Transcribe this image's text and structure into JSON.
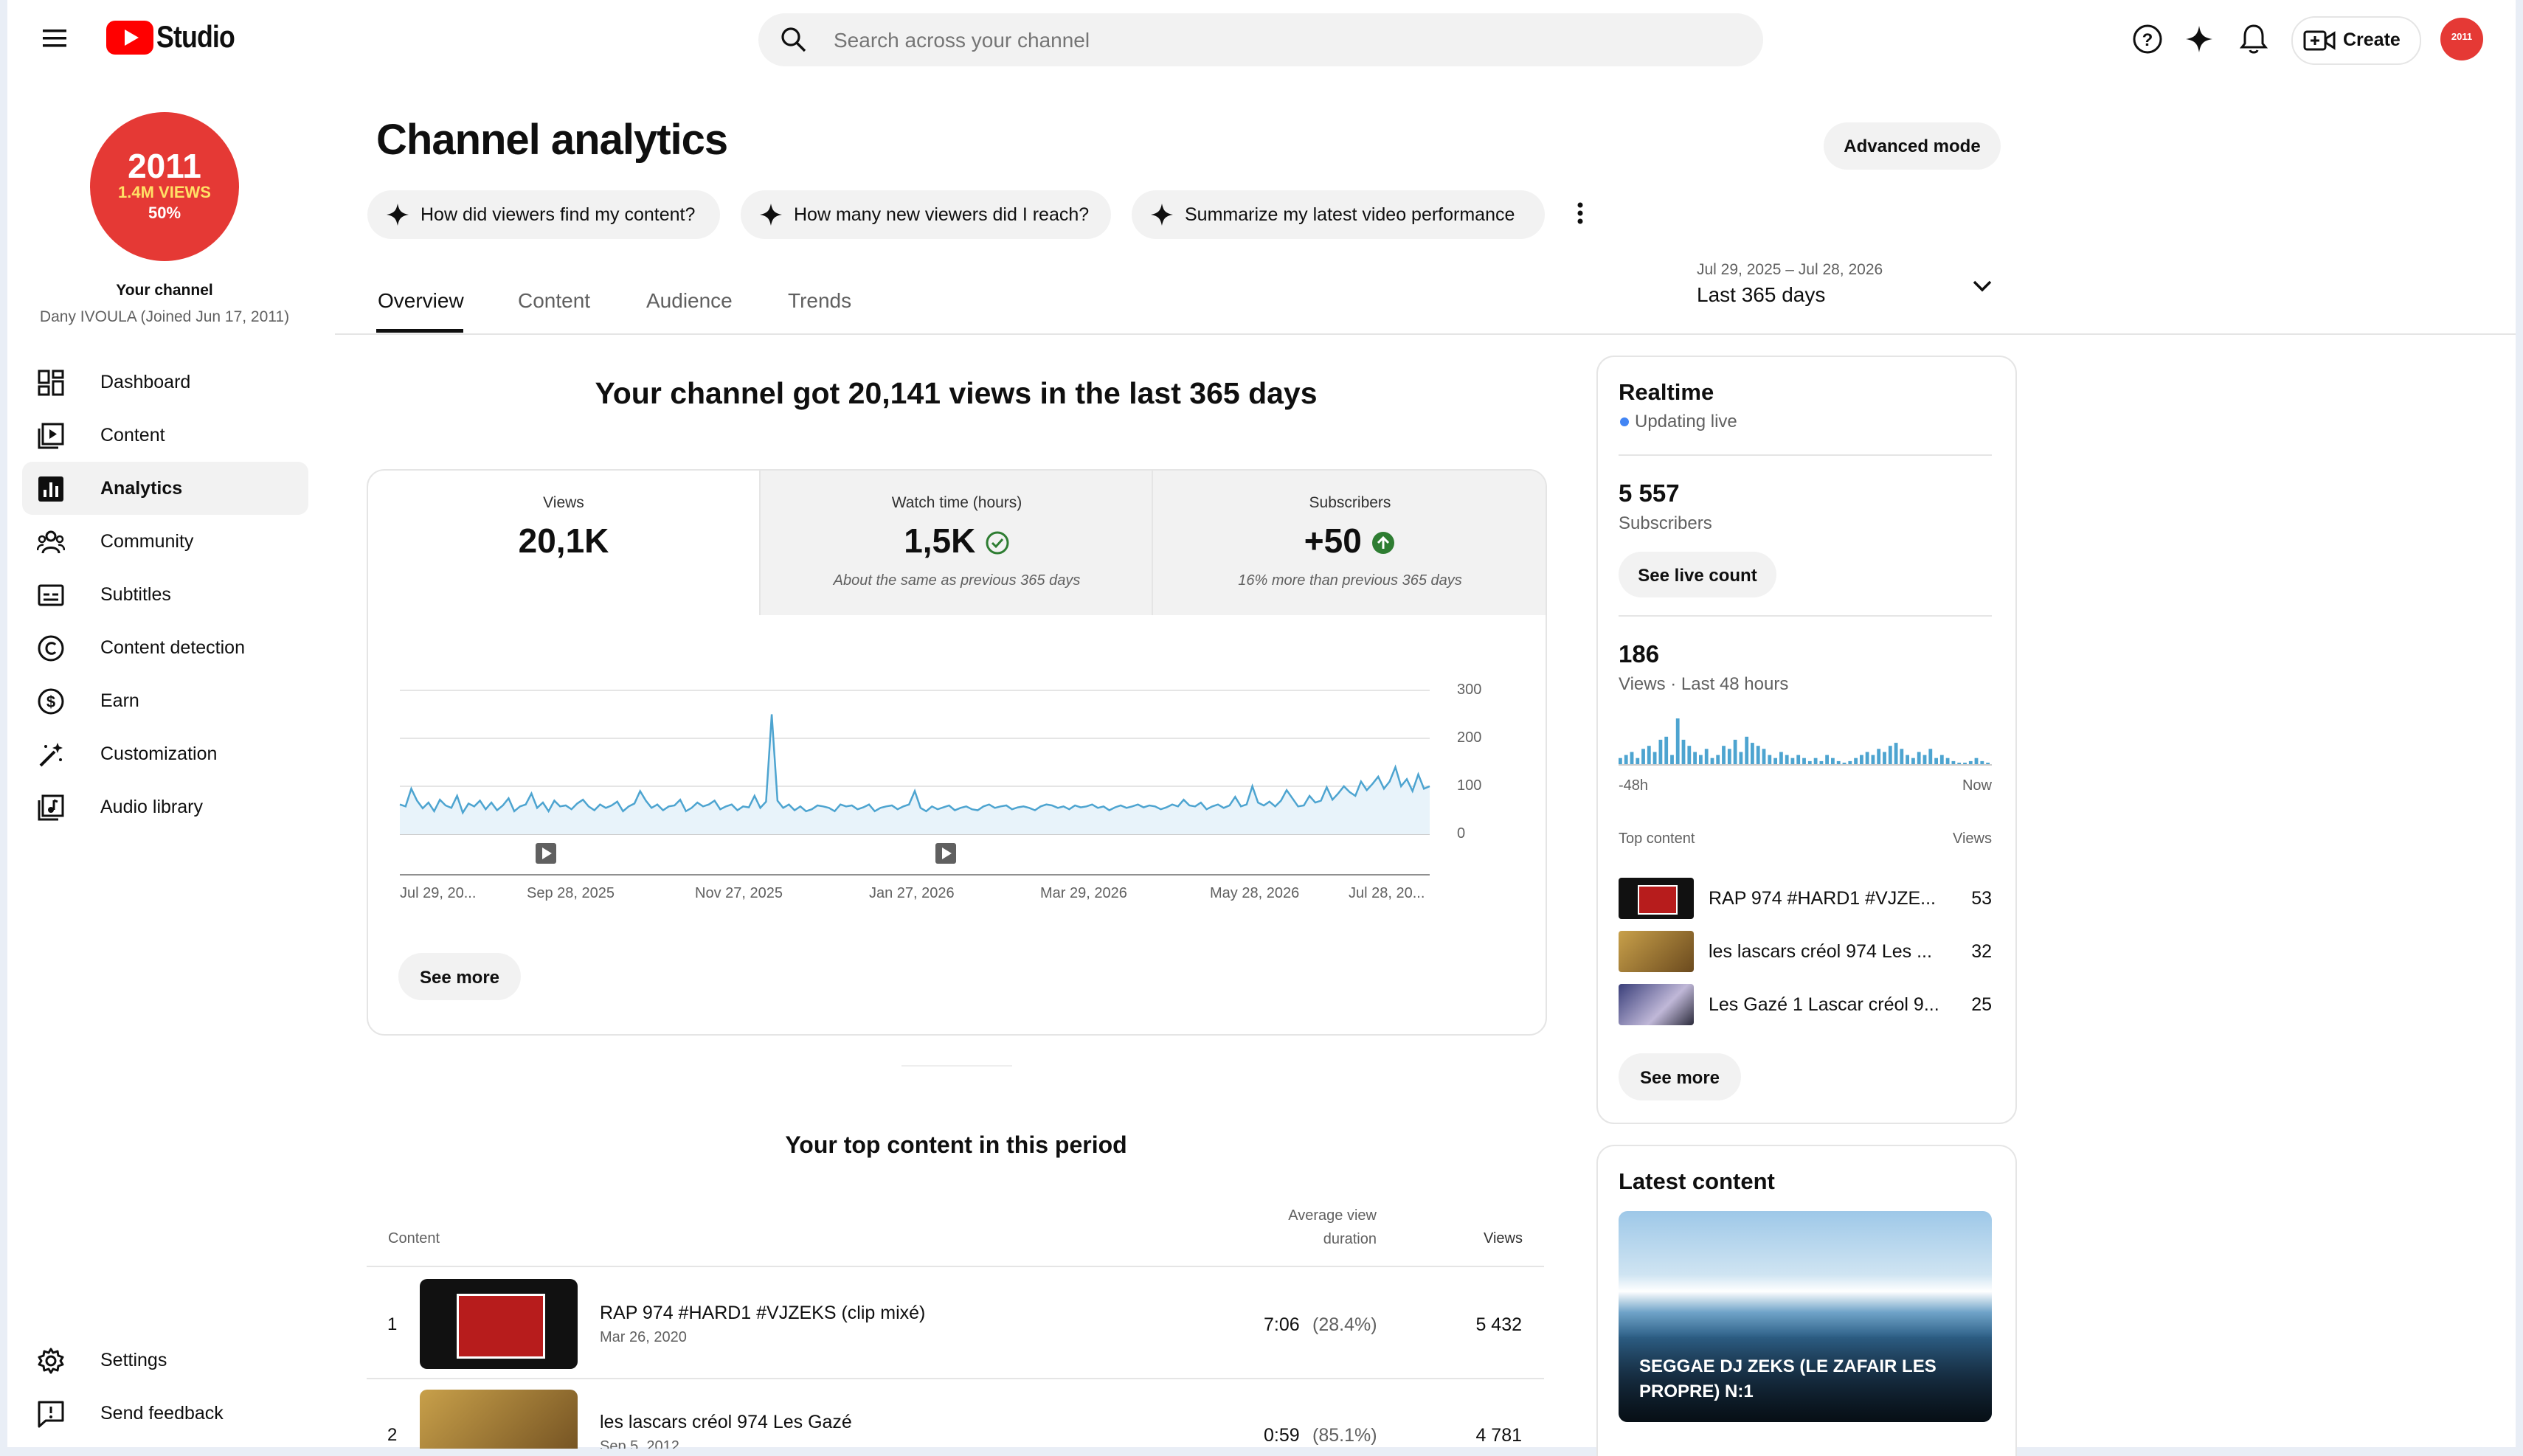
{
  "header": {
    "logo_text": "Studio",
    "search_placeholder": "Search across your channel",
    "create_label": "Create",
    "avatar_text": "2011",
    "icons": [
      "menu-icon",
      "search-icon",
      "help-icon",
      "sparkle-icon",
      "bell-icon",
      "create-video-icon"
    ]
  },
  "sidebar": {
    "channel_badge": {
      "line1": "2011",
      "line2": "1.4M VIEWS",
      "line3": "50%"
    },
    "channel_label": "Your channel",
    "channel_owner": "Dany IVOULA (Joined Jun 17, 2011)",
    "items": [
      {
        "label": "Dashboard",
        "icon": "dashboard-icon"
      },
      {
        "label": "Content",
        "icon": "content-icon"
      },
      {
        "label": "Analytics",
        "icon": "analytics-icon",
        "active": true
      },
      {
        "label": "Community",
        "icon": "community-icon"
      },
      {
        "label": "Subtitles",
        "icon": "subtitles-icon"
      },
      {
        "label": "Content detection",
        "icon": "copyright-icon"
      },
      {
        "label": "Earn",
        "icon": "dollar-icon"
      },
      {
        "label": "Customization",
        "icon": "magic-wand-icon"
      },
      {
        "label": "Audio library",
        "icon": "audio-library-icon"
      }
    ],
    "bottom_items": [
      {
        "label": "Settings",
        "icon": "gear-icon"
      },
      {
        "label": "Send feedback",
        "icon": "feedback-icon"
      }
    ]
  },
  "page": {
    "title": "Channel analytics",
    "advanced_mode": "Advanced mode",
    "chips": [
      "How did viewers find my content?",
      "How many new viewers did I reach?",
      "Summarize my latest video performance"
    ],
    "tabs": [
      "Overview",
      "Content",
      "Audience",
      "Trends"
    ],
    "active_tab": "Overview",
    "date_range": {
      "dates": "Jul 29, 2025 – Jul 28, 2026",
      "label": "Last 365 days"
    }
  },
  "overview": {
    "headline": "Your channel got 20,141 views in the last 365 days",
    "metrics": [
      {
        "label": "Views",
        "value": "20,1K",
        "note": ""
      },
      {
        "label": "Watch time (hours)",
        "value": "1,5K",
        "note": "About the same as previous 365 days",
        "status": "check"
      },
      {
        "label": "Subscribers",
        "value": "+50",
        "note": "16% more than previous 365 days",
        "status": "up"
      }
    ],
    "see_more": "See more"
  },
  "chart_data": {
    "type": "line",
    "title": "",
    "series": [
      {
        "values": [
          62,
          58,
          95,
          70,
          54,
          66,
          48,
          72,
          60,
          55,
          80,
          45,
          64,
          58,
          70,
          52,
          66,
          50,
          60,
          75,
          48,
          58,
          62,
          85,
          55,
          66,
          48,
          70,
          58,
          60,
          52,
          64,
          72,
          58,
          50,
          62,
          55,
          60,
          68,
          48,
          58,
          64,
          90,
          70,
          55,
          62,
          50,
          58,
          60,
          72,
          48,
          55,
          66,
          58,
          62,
          70,
          52,
          58,
          62,
          50,
          58,
          56,
          80,
          55,
          68,
          250,
          70,
          55,
          62,
          50,
          58,
          48,
          52,
          60,
          58,
          55,
          48,
          62,
          58,
          60,
          52,
          56,
          62,
          48,
          55,
          58,
          60,
          52,
          58,
          62,
          90,
          55,
          48,
          58,
          52,
          56,
          60,
          50,
          55,
          58,
          52,
          50,
          58,
          62,
          55,
          58,
          60,
          52,
          56,
          58,
          55,
          50,
          58,
          62,
          60,
          55,
          58,
          52,
          60,
          56,
          58,
          62,
          55,
          58,
          50,
          56,
          60,
          55,
          58,
          62,
          56,
          60,
          58,
          52,
          56,
          62,
          58,
          72,
          60,
          58,
          66,
          52,
          58,
          62,
          55,
          60,
          78,
          58,
          62,
          100,
          66,
          60,
          68,
          58,
          70,
          92,
          75,
          58,
          60,
          80,
          66,
          70,
          98,
          72,
          85,
          100,
          88,
          80,
          110,
          92,
          105,
          120,
          95,
          110,
          140,
          100,
          115,
          90,
          125,
          95,
          100
        ]
      }
    ],
    "x_tick_labels": [
      "Jul 29, 20...",
      "Sep 28, 2025",
      "Nov 27, 2025",
      "Jan 27, 2026",
      "Mar 29, 2026",
      "May 28, 2026",
      "Jul 28, 20..."
    ],
    "y_tick_labels": [
      "300",
      "200",
      "100",
      "0"
    ],
    "ylim": [
      0,
      300
    ],
    "grid": true,
    "color": "#4da4d0",
    "markers": [
      "video-marker-icon",
      "video-marker-icon"
    ]
  },
  "realtime": {
    "title": "Realtime",
    "status": "Updating live",
    "subscribers_value": "5 557",
    "subscribers_label": "Subscribers",
    "see_live_count": "See live count",
    "views_value": "186",
    "views_label": "Views · Last 48 hours",
    "bars": [
      2,
      3,
      4,
      2,
      5,
      6,
      4,
      8,
      9,
      3,
      15,
      8,
      6,
      4,
      3,
      5,
      2,
      3,
      6,
      5,
      8,
      4,
      9,
      7,
      6,
      5,
      3,
      2,
      4,
      3,
      2,
      3,
      2,
      1,
      2,
      1,
      3,
      2,
      1,
      0,
      1,
      2,
      3,
      4,
      3,
      5,
      4,
      6,
      7,
      5,
      3,
      2,
      4,
      3,
      5,
      2,
      3,
      2,
      1,
      0,
      0,
      1,
      2,
      1,
      0
    ],
    "axis_left": "-48h",
    "axis_right": "Now",
    "top_content_label": "Top content",
    "views_col_label": "Views",
    "top_content": [
      {
        "title": "RAP 974 #HARD1 #VJZE...",
        "views": "53"
      },
      {
        "title": "les lascars créol 974 Les ...",
        "views": "32"
      },
      {
        "title": "Les Gazé 1 Lascar créol 9...",
        "views": "25"
      }
    ],
    "see_more": "See more"
  },
  "latest": {
    "title": "Latest content",
    "video_title": "SEGGAE DJ ZEKS (LE ZAFAIR LES PROPRE) N:1"
  },
  "top_period": {
    "title": "Your top content in this period",
    "col_content": "Content",
    "col_avg": "Average view duration",
    "col_views": "Views",
    "rows": [
      {
        "rank": "1",
        "title": "RAP 974 #HARD1 #VJZEKS (clip mixé)",
        "date": "Mar 26, 2020",
        "avg": "7:06",
        "pct": "(28.4%)",
        "views": "5 432"
      },
      {
        "rank": "2",
        "title": "les lascars créol 974 Les Gazé",
        "date": "Sep 5, 2012",
        "avg": "0:59",
        "pct": "(85.1%)",
        "views": "4 781"
      }
    ]
  },
  "colors": {
    "accent": "#065fd4",
    "brand_red": "#ff0000",
    "chart_line": "#4da4d0",
    "live_dot": "#4285f4",
    "up_green": "#2e7d32"
  }
}
